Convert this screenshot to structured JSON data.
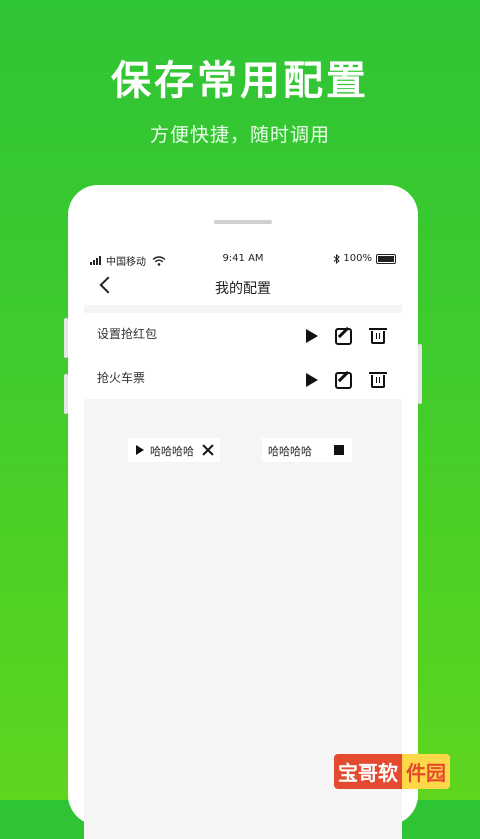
{
  "banner": {
    "title": "保存常用配置",
    "subtitle": "方便快捷，随时调用"
  },
  "statusbar": {
    "carrier": "中国移动",
    "time": "9:41 AM",
    "battery": "100%"
  },
  "navbar": {
    "title": "我的配置"
  },
  "configs": [
    {
      "label": "设置抢红包"
    },
    {
      "label": "抢火车票"
    }
  ],
  "floating": {
    "running_label": "哈哈哈哈",
    "stopped_label": "哈哈哈哈"
  },
  "watermark": {
    "part1": "宝哥软",
    "part2": "件园"
  },
  "icons": {
    "play": "play-icon",
    "edit": "edit-icon",
    "delete": "trash-icon",
    "close": "close-icon",
    "stop": "stop-icon"
  }
}
